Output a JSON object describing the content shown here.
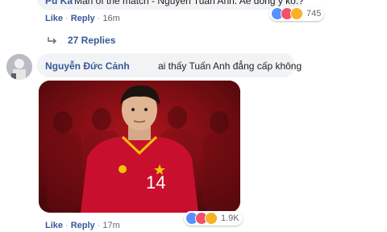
{
  "comment_top": {
    "author": "Pu Ka",
    "text": "Man of the match - Nguyễn Tuấn Anh. Ae đồng ý ko.?",
    "like_label": "Like",
    "reply_label": "Reply",
    "time": "16m",
    "reaction_count": "745"
  },
  "replies": {
    "label": "27 Replies"
  },
  "comment_main": {
    "author": "Nguyễn Đức Cảnh",
    "text": "ai thấy Tuấn Anh đẳng cấp không",
    "jersey_number": "14",
    "like_label": "Like",
    "reply_label": "Reply",
    "time": "17m",
    "reaction_count": "1.9K"
  },
  "colors": {
    "link": "#385898",
    "bubble": "#f2f3f5",
    "jersey": "#c8102e",
    "photo_bg": "#8b1217"
  },
  "icons": [
    "like-reaction-icon",
    "love-reaction-icon",
    "haha-reaction-icon",
    "reply-arrow-icon",
    "star-icon"
  ]
}
